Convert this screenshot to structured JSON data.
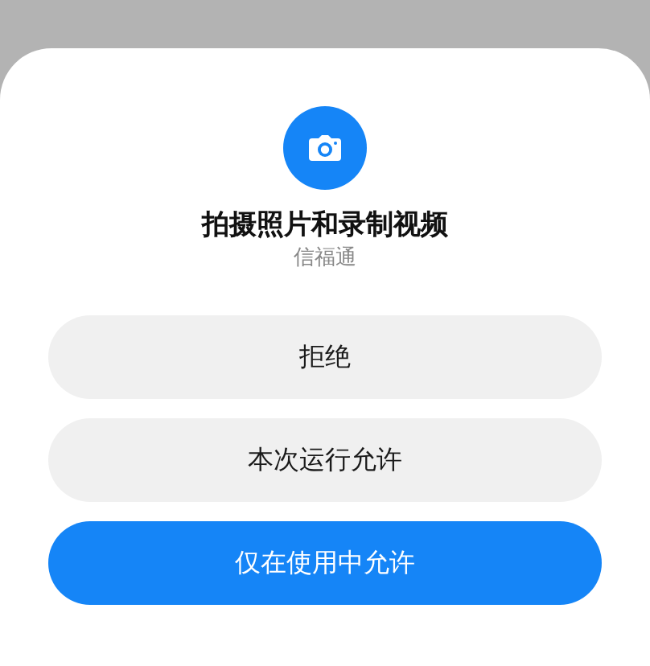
{
  "dialog": {
    "title": "拍摄照片和录制视频",
    "app_name": "信福通"
  },
  "buttons": [
    {
      "label": "拒绝",
      "kind": "secondary"
    },
    {
      "label": "本次运行允许",
      "kind": "secondary"
    },
    {
      "label": "仅在使用中允许",
      "kind": "primary"
    }
  ]
}
